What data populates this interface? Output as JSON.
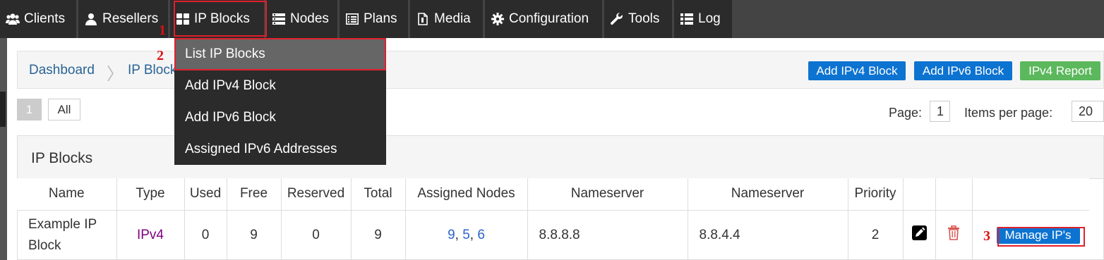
{
  "nav": {
    "items": [
      {
        "label": "Clients",
        "icon": "users-icon"
      },
      {
        "label": "Resellers",
        "icon": "user-icon"
      },
      {
        "label": "IP Blocks",
        "icon": "grid-icon"
      },
      {
        "label": "Nodes",
        "icon": "server-icon"
      },
      {
        "label": "Plans",
        "icon": "list-icon"
      },
      {
        "label": "Media",
        "icon": "file-icon"
      },
      {
        "label": "Configuration",
        "icon": "gear-icon"
      },
      {
        "label": "Tools",
        "icon": "wrench-icon"
      },
      {
        "label": "Log",
        "icon": "list-icon"
      }
    ]
  },
  "annotations": {
    "one": "1",
    "two": "2",
    "three": "3"
  },
  "dropdown": {
    "items": [
      "List IP Blocks",
      "Add IPv4 Block",
      "Add IPv6 Block",
      "Assigned IPv6 Addresses"
    ]
  },
  "breadcrumb": {
    "home": "Dashboard",
    "current": "IP Blocks"
  },
  "actions": {
    "add_ipv4": "Add IPv4 Block",
    "add_ipv6": "Add IPv6 Block",
    "ipv4_report": "IPv4 Report"
  },
  "pager": {
    "page_button": "1",
    "all_button": "All",
    "page_label": "Page:",
    "page_value": "1",
    "items_label": "Items per page:",
    "items_value": "20"
  },
  "panel": {
    "title": "IP Blocks"
  },
  "table": {
    "headers": [
      "Name",
      "Type",
      "Used",
      "Free",
      "Reserved",
      "Total",
      "Assigned Nodes",
      "Nameserver",
      "Nameserver",
      "Priority"
    ],
    "row": {
      "name_line1": "Example IP",
      "name_line2": "Block",
      "type": "IPv4",
      "used": "0",
      "free": "9",
      "reserved": "0",
      "total": "9",
      "nodes": [
        "9",
        "5",
        "6"
      ],
      "ns1": "8.8.8.8",
      "ns2": "8.8.4.4",
      "priority": "2",
      "manage": "Manage IP's"
    }
  },
  "colors": {
    "accent": "#0d73d1",
    "green": "#5cb85c",
    "highlight": "#e0202c"
  }
}
